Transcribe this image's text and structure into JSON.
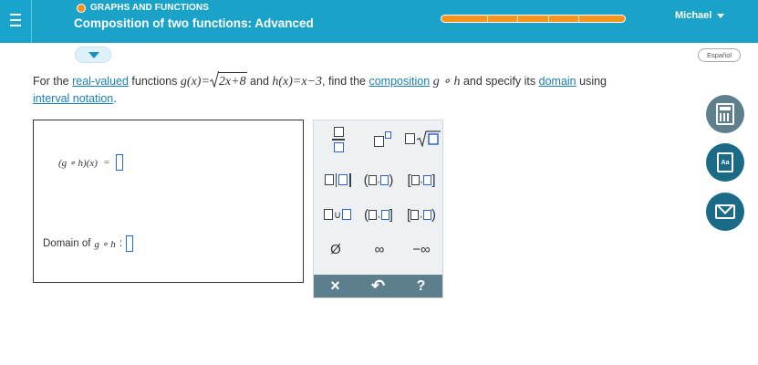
{
  "header": {
    "subject": "GRAPHS AND FUNCTIONS",
    "topic": "Composition of two functions: Advanced",
    "user": "Michael",
    "progress_segments": 5
  },
  "language_button": "Español",
  "question": {
    "prefix": "For the ",
    "link_real_valued": "real-valued",
    "text_functions": " functions ",
    "g_def_lhs": "g(x)=",
    "g_radicand": "2x+8",
    "text_and": " and ",
    "h_def": "h(x)=x−3",
    "text_find": ", find the ",
    "link_composition": "composition",
    "comp_symbol": " g ∘ h ",
    "text_specify": "and specify its ",
    "link_domain": "domain",
    "text_using": " using ",
    "link_interval": "interval notation",
    "period": "."
  },
  "answer": {
    "composition_label": "(g ∘ h)(x)",
    "equals": "=",
    "domain_label": "Domain of",
    "domain_fn": "g ∘ h",
    "colon": ":"
  },
  "keypad": {
    "empty_set": "Ø",
    "infinity": "∞",
    "neg_infinity": "−∞",
    "union": "∪",
    "clear": "×",
    "undo": "↶",
    "help": "?"
  },
  "colors": {
    "header_bg": "#1aa2c9",
    "progress": "#f7941d",
    "link": "#1a7fb3",
    "keypad_bottom": "#5c7e8d",
    "tool_bg": "#5f7f8d"
  }
}
